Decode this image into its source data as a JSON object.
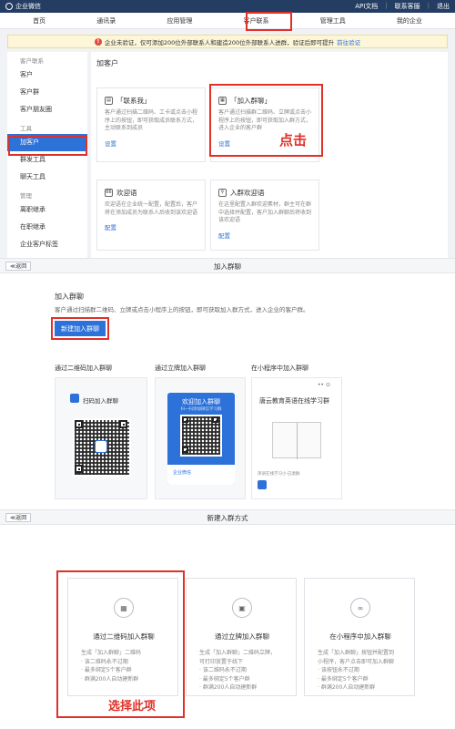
{
  "topbar": {
    "app_name": "企业微信",
    "links": [
      "API文档",
      "联系客服",
      "退出"
    ]
  },
  "nav": {
    "items": [
      "首页",
      "通讯录",
      "应用管理",
      "客户联系",
      "管理工具",
      "我的企业"
    ],
    "active": "客户联系"
  },
  "notice": {
    "text": "企业未验证，仅可添加200位外部联系人和建造200位外部联系人进群，验证后即可提升",
    "link": "前往验证"
  },
  "sidebar": {
    "group1": "客户联系",
    "items1": [
      "客户",
      "客户群",
      "客户朋友圈"
    ],
    "group2": "工具",
    "items2": [
      "加客户",
      "群发工具",
      "聊天工具"
    ],
    "group3": "管理",
    "items3": [
      "离职继承",
      "在职继承",
      "企业客户标签"
    ],
    "active": "加客户"
  },
  "add_customer": {
    "title": "加客户",
    "cards": [
      {
        "title": "「联系我」",
        "desc": "客户通过扫描二维码、工卡或点击小程序上的按钮，即可获取成员联系方式，主动联系到成员",
        "link": "设置"
      },
      {
        "title": "「加入群聊」",
        "desc": "客户通过扫描群二维码、立牌或点击小程序上的按钮，即可获取加入群方式，进入企业的客户群",
        "link": "设置"
      },
      {
        "title": "欢迎语",
        "desc": "欢迎语在企业统一配置，配置后，客户将在添加成员为联系人后收到该欢迎语",
        "link": "配置"
      },
      {
        "title": "入群欢迎语",
        "desc": "在这里配置入群欢迎素材，群主可在群中选择并配置，客户加入群聊后将收到该欢迎语",
        "link": "配置"
      }
    ],
    "annotation": "点击"
  },
  "join_group": {
    "back": "返回",
    "header": "加入群聊",
    "title": "加入群聊",
    "desc": "客户通过扫描群二维码、立牌或点击小程序上的按钮，即可获取加入群方式，进入企业的客户群。",
    "new_button": "新建加入群聊",
    "methods": [
      {
        "label": "通过二维码加入群聊",
        "card_title": "扫码加入群聊"
      },
      {
        "label": "通过立牌加入群聊",
        "card_title": "欢迎加入群聊",
        "card_sub": "扫一扫添加微信学习群",
        "footer": "企业微信"
      },
      {
        "label": "在小程序中加入群聊",
        "card_title": "唐云教育英语在线学习群",
        "footer": "英语在线学习小·已退群"
      }
    ]
  },
  "new_method": {
    "back": "返回",
    "header": "新建入群方式",
    "options": [
      {
        "title": "通过二维码加入群聊",
        "lines": [
          "生成「加入群聊」二维码",
          "· 该二维码永不过期",
          "· 最多绑定5个客户群",
          "· 群满200人自动建新群"
        ]
      },
      {
        "title": "通过立牌加入群聊",
        "lines": [
          "生成「加入群聊」二维码立牌，",
          "可打印放置于线下",
          "· 该二维码永不过期",
          "· 最多绑定5个客户群",
          "· 群满200人自动建新群"
        ]
      },
      {
        "title": "在小程序中加入群聊",
        "lines": [
          "生成「加入群聊」按钮并配置到",
          "小程序，客户点击即可加入群聊",
          "· 该按钮永不过期",
          "· 最多绑定5个客户群",
          "· 群满200人自动建新群"
        ]
      }
    ],
    "annotation": "选择此项"
  },
  "colors": {
    "accent": "#2d72d9",
    "annotation": "#e03027",
    "topbar": "#243d63"
  }
}
